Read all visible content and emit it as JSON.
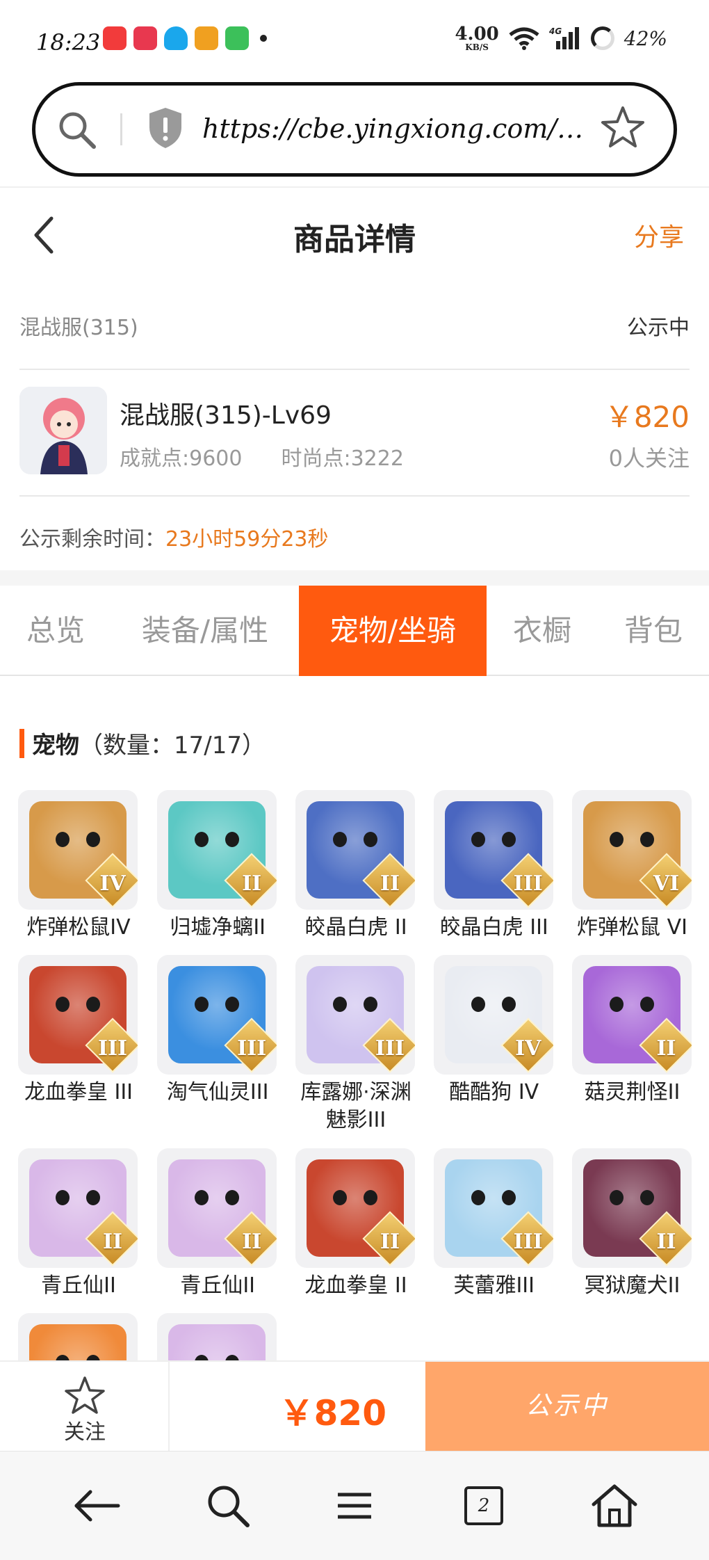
{
  "status_bar": {
    "time": "18:23",
    "network_speed": "4.00",
    "network_unit": "KB/S",
    "signal_label": "4G",
    "battery": "42%",
    "app_icons": [
      "app-red-icon",
      "app-heart-icon",
      "qq-icon",
      "app-orange-icon",
      "app-green-icon"
    ]
  },
  "browser": {
    "url": "https://cbe.yingxiong.com/…"
  },
  "header": {
    "title": "商品详情",
    "share_label": "分享"
  },
  "item": {
    "server": "混战服(315)",
    "status": "公示中",
    "title": "混战服(315)-Lv69",
    "achievement": "成就点:9600",
    "fashion": "时尚点:3222",
    "price": "￥820",
    "followers": "0人关注",
    "countdown_label": "公示剩余时间：",
    "countdown_value": "23小时59分23秒"
  },
  "tabs": [
    {
      "label": "总览",
      "active": false
    },
    {
      "label": "装备/属性",
      "active": false
    },
    {
      "label": "宠物/坐骑",
      "active": true
    },
    {
      "label": "衣橱",
      "active": false
    },
    {
      "label": "背包",
      "active": false
    }
  ],
  "pets_section": {
    "title": "宠物",
    "count_label": "（数量：17/17）",
    "pets": [
      {
        "name": "炸弹松鼠IV",
        "grade": "IV",
        "color": "#d79a4a"
      },
      {
        "name": "归墟净螭II",
        "grade": "II",
        "color": "#5cc8c4"
      },
      {
        "name": "皎晶白虎 II",
        "grade": "II",
        "color": "#4e6fc4"
      },
      {
        "name": "皎晶白虎 III",
        "grade": "III",
        "color": "#4a66c0"
      },
      {
        "name": "炸弹松鼠 VI",
        "grade": "VI",
        "color": "#d79a4a"
      },
      {
        "name": "龙血拳皇 III",
        "grade": "III",
        "color": "#c9472f"
      },
      {
        "name": "淘气仙灵III",
        "grade": "III",
        "color": "#3b8fe0"
      },
      {
        "name": "库露娜·深渊魅影III",
        "grade": "III",
        "color": "#cfc3ef"
      },
      {
        "name": "酷酷狗 IV",
        "grade": "IV",
        "color": "#e9ecf2"
      },
      {
        "name": "菇灵荆怪II",
        "grade": "II",
        "color": "#a868d8"
      },
      {
        "name": "青丘仙II",
        "grade": "II",
        "color": "#d9b8e8"
      },
      {
        "name": "青丘仙II",
        "grade": "II",
        "color": "#d9b8e8"
      },
      {
        "name": "龙血拳皇 II",
        "grade": "II",
        "color": "#c9472f"
      },
      {
        "name": "芙蕾雅III",
        "grade": "III",
        "color": "#a9d4ef"
      },
      {
        "name": "冥狱魔犬II",
        "grade": "II",
        "color": "#7a3a52"
      },
      {
        "name": "",
        "grade": "",
        "color": "#f08a3a"
      },
      {
        "name": "",
        "grade": "",
        "color": "#d9b8e8"
      }
    ]
  },
  "action_bar": {
    "follow_label": "关注",
    "price": "￥820",
    "status_button": "公示中"
  },
  "nav": {
    "tab_count": "2"
  }
}
